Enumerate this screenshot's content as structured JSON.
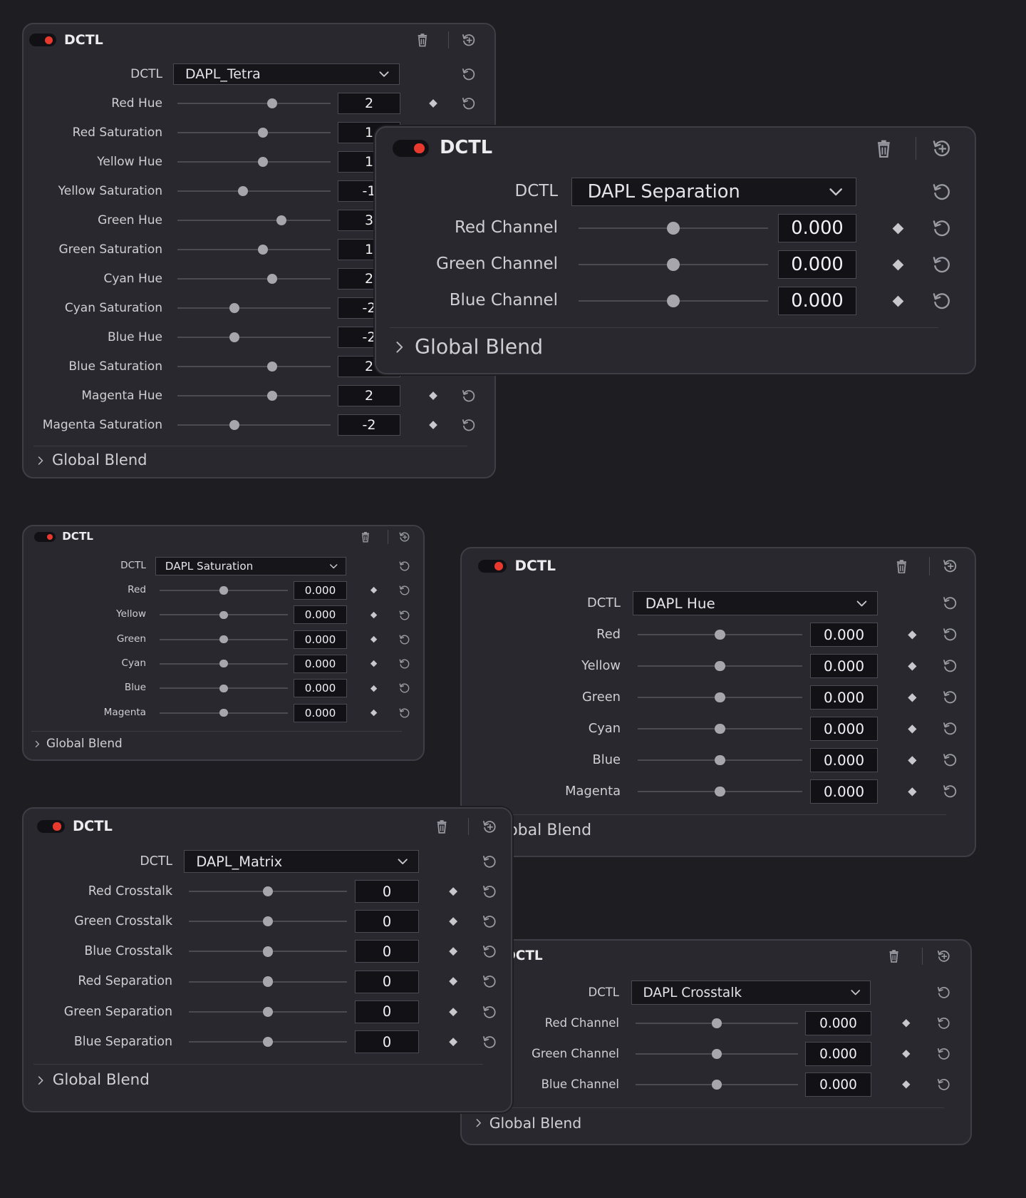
{
  "panels": [
    {
      "id": "tetra",
      "title": "DCTL",
      "dctl_label": "DCTL",
      "selected": "DAPL_Tetra",
      "params": [
        {
          "label": "Red Hue",
          "value": "2",
          "pos": 0.62
        },
        {
          "label": "Red Saturation",
          "value": "1",
          "pos": 0.56
        },
        {
          "label": "Yellow Hue",
          "value": "1",
          "pos": 0.56
        },
        {
          "label": "Yellow Saturation",
          "value": "-1",
          "pos": 0.43
        },
        {
          "label": "Green Hue",
          "value": "3",
          "pos": 0.68
        },
        {
          "label": "Green Saturation",
          "value": "1",
          "pos": 0.56
        },
        {
          "label": "Cyan Hue",
          "value": "2",
          "pos": 0.62
        },
        {
          "label": "Cyan Saturation",
          "value": "-2",
          "pos": 0.37
        },
        {
          "label": "Blue Hue",
          "value": "-2",
          "pos": 0.37
        },
        {
          "label": "Blue Saturation",
          "value": "2",
          "pos": 0.62
        },
        {
          "label": "Magenta Hue",
          "value": "2",
          "pos": 0.62
        },
        {
          "label": "Magenta Saturation",
          "value": "-2",
          "pos": 0.37
        }
      ],
      "footer": "Global Blend"
    },
    {
      "id": "separation",
      "title": "DCTL",
      "dctl_label": "DCTL",
      "selected": "DAPL Separation",
      "params": [
        {
          "label": "Red Channel",
          "value": "0.000",
          "pos": 0.5
        },
        {
          "label": "Green Channel",
          "value": "0.000",
          "pos": 0.5
        },
        {
          "label": "Blue Channel",
          "value": "0.000",
          "pos": 0.5
        }
      ],
      "footer": "Global Blend"
    },
    {
      "id": "saturation",
      "title": "DCTL",
      "dctl_label": "DCTL",
      "selected": "DAPL Saturation",
      "params": [
        {
          "label": "Red",
          "value": "0.000",
          "pos": 0.5
        },
        {
          "label": "Yellow",
          "value": "0.000",
          "pos": 0.5
        },
        {
          "label": "Green",
          "value": "0.000",
          "pos": 0.5
        },
        {
          "label": "Cyan",
          "value": "0.000",
          "pos": 0.5
        },
        {
          "label": "Blue",
          "value": "0.000",
          "pos": 0.5
        },
        {
          "label": "Magenta",
          "value": "0.000",
          "pos": 0.5
        }
      ],
      "footer": "Global Blend"
    },
    {
      "id": "hue",
      "title": "DCTL",
      "dctl_label": "DCTL",
      "selected": "DAPL Hue",
      "params": [
        {
          "label": "Red",
          "value": "0.000",
          "pos": 0.5
        },
        {
          "label": "Yellow",
          "value": "0.000",
          "pos": 0.5
        },
        {
          "label": "Green",
          "value": "0.000",
          "pos": 0.5
        },
        {
          "label": "Cyan",
          "value": "0.000",
          "pos": 0.5
        },
        {
          "label": "Blue",
          "value": "0.000",
          "pos": 0.5
        },
        {
          "label": "Magenta",
          "value": "0.000",
          "pos": 0.5
        }
      ],
      "footer": "Global Blend"
    },
    {
      "id": "crosstalk",
      "title": "DCTL",
      "dctl_label": "DCTL",
      "selected": "DAPL Crosstalk",
      "params": [
        {
          "label": "Red Channel",
          "value": "0.000",
          "pos": 0.5
        },
        {
          "label": "Green Channel",
          "value": "0.000",
          "pos": 0.5
        },
        {
          "label": "Blue Channel",
          "value": "0.000",
          "pos": 0.5
        }
      ],
      "footer": "Global Blend"
    },
    {
      "id": "matrix",
      "title": "DCTL",
      "dctl_label": "DCTL",
      "selected": "DAPL_Matrix",
      "params": [
        {
          "label": "Red Crosstalk",
          "value": "0",
          "pos": 0.5
        },
        {
          "label": "Green Crosstalk",
          "value": "0",
          "pos": 0.5
        },
        {
          "label": "Blue Crosstalk",
          "value": "0",
          "pos": 0.5
        },
        {
          "label": "Red Separation",
          "value": "0",
          "pos": 0.5
        },
        {
          "label": "Green Separation",
          "value": "0",
          "pos": 0.5
        },
        {
          "label": "Blue Separation",
          "value": "0",
          "pos": 0.5
        }
      ],
      "footer": "Global Blend"
    }
  ],
  "icons": {
    "enable": "red-dot-toggle-icon",
    "delete": "trash-icon",
    "reset_all": "reset-plus-icon",
    "reset": "reset-arrow-icon",
    "keyframe": "diamond-icon",
    "dropdown": "chevron-down-icon",
    "expand": "chevron-right-icon"
  },
  "colors": {
    "background": "#1d1d22",
    "panel": "#28282e",
    "accent_red": "#e8392e",
    "value_box": "#121216"
  }
}
